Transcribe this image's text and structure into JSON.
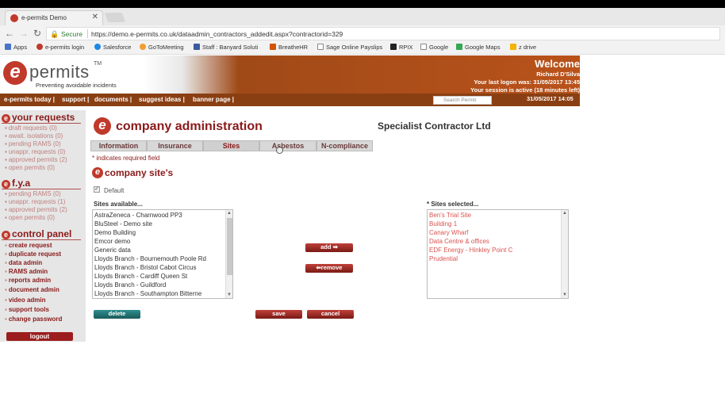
{
  "browser": {
    "tab_title": "e-permits Demo",
    "security_label": "Secure",
    "url": "https://demo.e-permits.co.uk/dataadmin_contractors_addedit.aspx?contractorid=329",
    "bookmarks": [
      "Apps",
      "e-permits login",
      "Salesforce",
      "GoToMeeting",
      "Staff : Banyard Soluti",
      "BreatheHR",
      "Sage Online Payslips",
      "RPIX",
      "Google",
      "Google Maps",
      "z drive"
    ]
  },
  "header": {
    "logo_text": "permits",
    "logo_tm": "TM",
    "tagline": "Preventing avoidable incidents",
    "welcome": "Welcome",
    "user": "Richard D'Silva",
    "last_logon": "Your last logon was: 31/05/2017 13:45",
    "session": "Your session is active  (18 minutes left)",
    "datetime": "31/05/2017 14:05",
    "search_placeholder": "Search Permit"
  },
  "nav": [
    "e-permits today |",
    "support |",
    "documents |",
    "suggest ideas |",
    "banner page |"
  ],
  "sidebar": {
    "your_requests": "your requests",
    "requests": [
      "draft requests (0)",
      "await. isolations (0)",
      "pending RAMS (0)",
      "unappr. requests (0)",
      "approved permits (2)",
      "open permits (0)"
    ],
    "fya": "f.y.a",
    "fya_items": [
      "pending RAMS (0)",
      "unappr. requests (1)",
      "approved permits (2)",
      "open permits (0)"
    ],
    "control_panel": "control panel",
    "control_items": [
      "create request",
      "duplicate request",
      "data admin",
      "RAMS admin",
      "reports admin",
      "document admin",
      "video admin",
      "support tools",
      "change password"
    ],
    "logout": "logout"
  },
  "main": {
    "title": "company administration",
    "company": "Specialist Contractor Ltd",
    "tabs": [
      "Information",
      "Insurance",
      "Sites",
      "Asbestos",
      "N-compliance"
    ],
    "required_note": "* indicates required field",
    "section": "company site's",
    "default_label": "Default",
    "avail_label": "Sites available...",
    "selected_label": "*  Sites selected...",
    "available": [
      "AstraZeneca - Charnwood PP3",
      "BluSteel - Demo site",
      "Demo Building",
      "Emcor demo",
      "Generic data",
      "Lloyds Branch - Bournemouth Poole Rd",
      "Lloyds Branch - Bristol Cabot Circus",
      "Lloyds Branch - Cardiff Queen St",
      "Lloyds Branch - Guildford",
      "Lloyds Branch - Southampton Bitterne"
    ],
    "selected": [
      "Ben's Trial Site",
      "Building 1",
      "Canary Wharf",
      "Data Centre & offices",
      "EDF Energy - Hinkley Point C",
      "Prudential"
    ],
    "add": "add",
    "remove": "remove",
    "delete": "delete",
    "save": "save",
    "cancel": "cancel"
  }
}
